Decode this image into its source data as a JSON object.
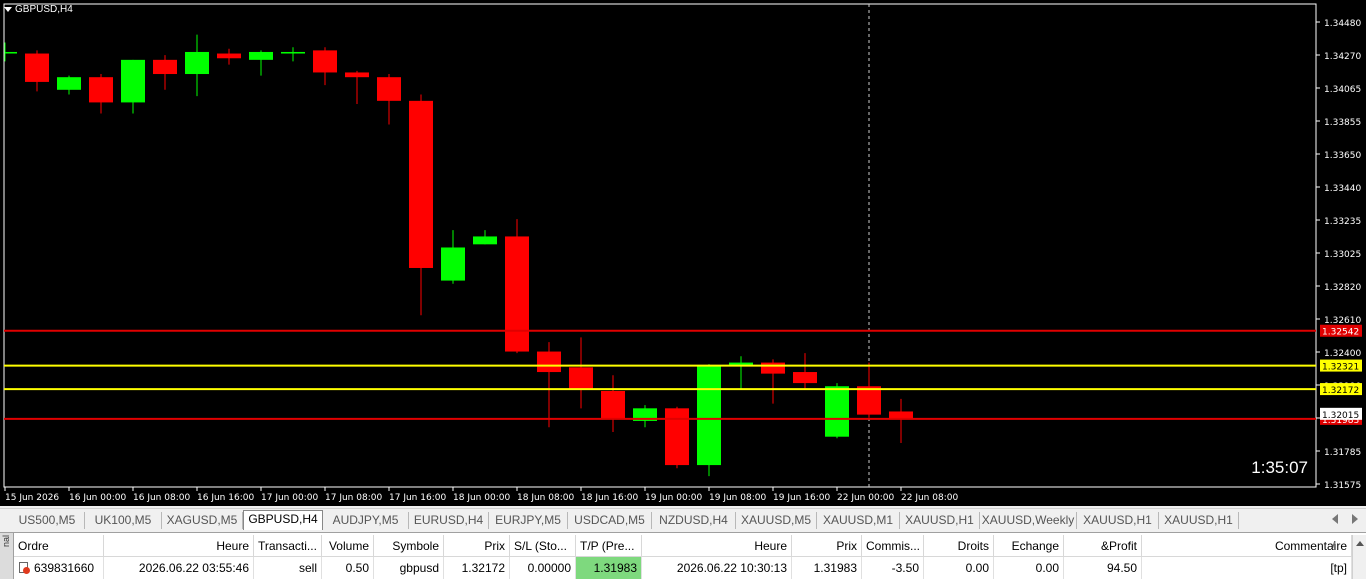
{
  "window": {
    "title": "GBPUSD,H4"
  },
  "chart": {
    "countdown": "1:35:07",
    "colors": {
      "bull": "#00ff00",
      "bear": "#ff0000",
      "background": "#000000",
      "text": "#ffffff",
      "sl_line": "#e00000",
      "entry_line": "#ffff00"
    }
  },
  "chart_data": {
    "type": "candlestick",
    "symbol": "GBPUSD",
    "timeframe": "H4",
    "y_range": [
      1.3157,
      1.345
    ],
    "price_ticks": [
      "1.34480",
      "1.34270",
      "1.34065",
      "1.33855",
      "1.33650",
      "1.33440",
      "1.33235",
      "1.33025",
      "1.32820",
      "1.32610",
      "1.32400",
      "1.32190",
      "1.31985",
      "1.31785",
      "1.31575"
    ],
    "time_labels": [
      "15 Jun 2026",
      "16 Jun 00:00",
      "16 Jun 08:00",
      "16 Jun 16:00",
      "17 Jun 00:00",
      "17 Jun 08:00",
      "17 Jun 16:00",
      "18 Jun 00:00",
      "18 Jun 08:00",
      "18 Jun 16:00",
      "19 Jun 00:00",
      "19 Jun 08:00",
      "19 Jun 16:00",
      "22 Jun 00:00",
      "22 Jun 08:00"
    ],
    "candles": [
      {
        "o": 1.343,
        "h": 1.3437,
        "l": 1.3425,
        "c": 1.3431
      },
      {
        "o": 1.343,
        "h": 1.3432,
        "l": 1.3406,
        "c": 1.3412
      },
      {
        "o": 1.3407,
        "h": 1.3416,
        "l": 1.3404,
        "c": 1.3415
      },
      {
        "o": 1.3415,
        "h": 1.3417,
        "l": 1.3392,
        "c": 1.3399
      },
      {
        "o": 1.3399,
        "h": 1.3426,
        "l": 1.3392,
        "c": 1.3426
      },
      {
        "o": 1.3426,
        "h": 1.3429,
        "l": 1.3407,
        "c": 1.3417
      },
      {
        "o": 1.3417,
        "h": 1.3442,
        "l": 1.3403,
        "c": 1.3431
      },
      {
        "o": 1.343,
        "h": 1.3433,
        "l": 1.3423,
        "c": 1.3427
      },
      {
        "o": 1.3426,
        "h": 1.3432,
        "l": 1.3416,
        "c": 1.3431
      },
      {
        "o": 1.343,
        "h": 1.3434,
        "l": 1.3425,
        "c": 1.3431
      },
      {
        "o": 1.3432,
        "h": 1.3434,
        "l": 1.341,
        "c": 1.3418
      },
      {
        "o": 1.3418,
        "h": 1.3419,
        "l": 1.3398,
        "c": 1.3415
      },
      {
        "o": 1.3415,
        "h": 1.3417,
        "l": 1.3385,
        "c": 1.34
      },
      {
        "o": 1.34,
        "h": 1.3404,
        "l": 1.3264,
        "c": 1.3294
      },
      {
        "o": 1.3286,
        "h": 1.3318,
        "l": 1.3284,
        "c": 1.3307
      },
      {
        "o": 1.3309,
        "h": 1.3318,
        "l": 1.3309,
        "c": 1.3314
      },
      {
        "o": 1.3314,
        "h": 1.3325,
        "l": 1.324,
        "c": 1.3241
      },
      {
        "o": 1.3241,
        "h": 1.3247,
        "l": 1.3193,
        "c": 1.3228
      },
      {
        "o": 1.3231,
        "h": 1.325,
        "l": 1.3205,
        "c": 1.3217
      },
      {
        "o": 1.3216,
        "h": 1.3226,
        "l": 1.319,
        "c": 1.3198
      },
      {
        "o": 1.3197,
        "h": 1.3207,
        "l": 1.3193,
        "c": 1.3205
      },
      {
        "o": 1.3205,
        "h": 1.3206,
        "l": 1.3167,
        "c": 1.3169
      },
      {
        "o": 1.3169,
        "h": 1.3233,
        "l": 1.3162,
        "c": 1.3232
      },
      {
        "o": 1.3232,
        "h": 1.3238,
        "l": 1.3217,
        "c": 1.3234
      },
      {
        "o": 1.3234,
        "h": 1.3236,
        "l": 1.3208,
        "c": 1.3227
      },
      {
        "o": 1.3228,
        "h": 1.324,
        "l": 1.3217,
        "c": 1.3221
      },
      {
        "o": 1.3187,
        "h": 1.3221,
        "l": 1.3186,
        "c": 1.3219
      },
      {
        "o": 1.3219,
        "h": 1.3234,
        "l": 1.3199,
        "c": 1.3201
      },
      {
        "o": 1.3203,
        "h": 1.3211,
        "l": 1.3183,
        "c": 1.3198
      }
    ],
    "levels": [
      {
        "price": 1.32542,
        "label": "1.32542",
        "color": "#e00000"
      },
      {
        "price": 1.32321,
        "label": "1.32321",
        "color": "#ffff00"
      },
      {
        "price": 1.32172,
        "label": "1.32172",
        "color": "#ffff00"
      },
      {
        "price": 1.31983,
        "label": "1.31983",
        "color": "#e00000"
      }
    ],
    "current_price_label": "1.32015",
    "crosshair_time": "22 Jun 00:00",
    "grid": false
  },
  "tabs": [
    "US500,M5",
    "UK100,M5",
    "XAGUSD,M5",
    "GBPUSD,H4",
    "AUDJPY,M5",
    "EURUSD,H4",
    "EURJPY,M5",
    "USDCAD,M5",
    "NZDUSD,H4",
    "XAUUSD,M5",
    "XAUUSD,M1",
    "XAUUSD,H1",
    "XAUUSD,Weekly",
    "XAUUSD,H1",
    "XAUUSD,H1"
  ],
  "active_tab": "GBPUSD,H4",
  "terminal": {
    "side_label": "nal",
    "columns": [
      "Ordre",
      "Heure",
      "Transacti...",
      "Volume",
      "Symbole",
      "Prix",
      "S/L (Sto...",
      "T/P (Pre...",
      "Heure",
      "Prix",
      "Commis...",
      "Droits",
      "Echange",
      "&Profit",
      "Commentaire"
    ],
    "sort_indicator": "/",
    "row": {
      "order": "639831660",
      "time": "2026.06.22 03:55:46",
      "type": "sell",
      "volume": "0.50",
      "symbol": "gbpusd",
      "price": "1.32172",
      "sl": "0.00000",
      "tp": "1.31983",
      "close_time": "2026.06.22 10:30:13",
      "close_price": "1.31983",
      "commission": "-3.50",
      "swap": "0.00",
      "exchange": "0.00",
      "profit": "94.50",
      "comment": "[tp]"
    },
    "tp_highlight": "#7ed97e"
  }
}
